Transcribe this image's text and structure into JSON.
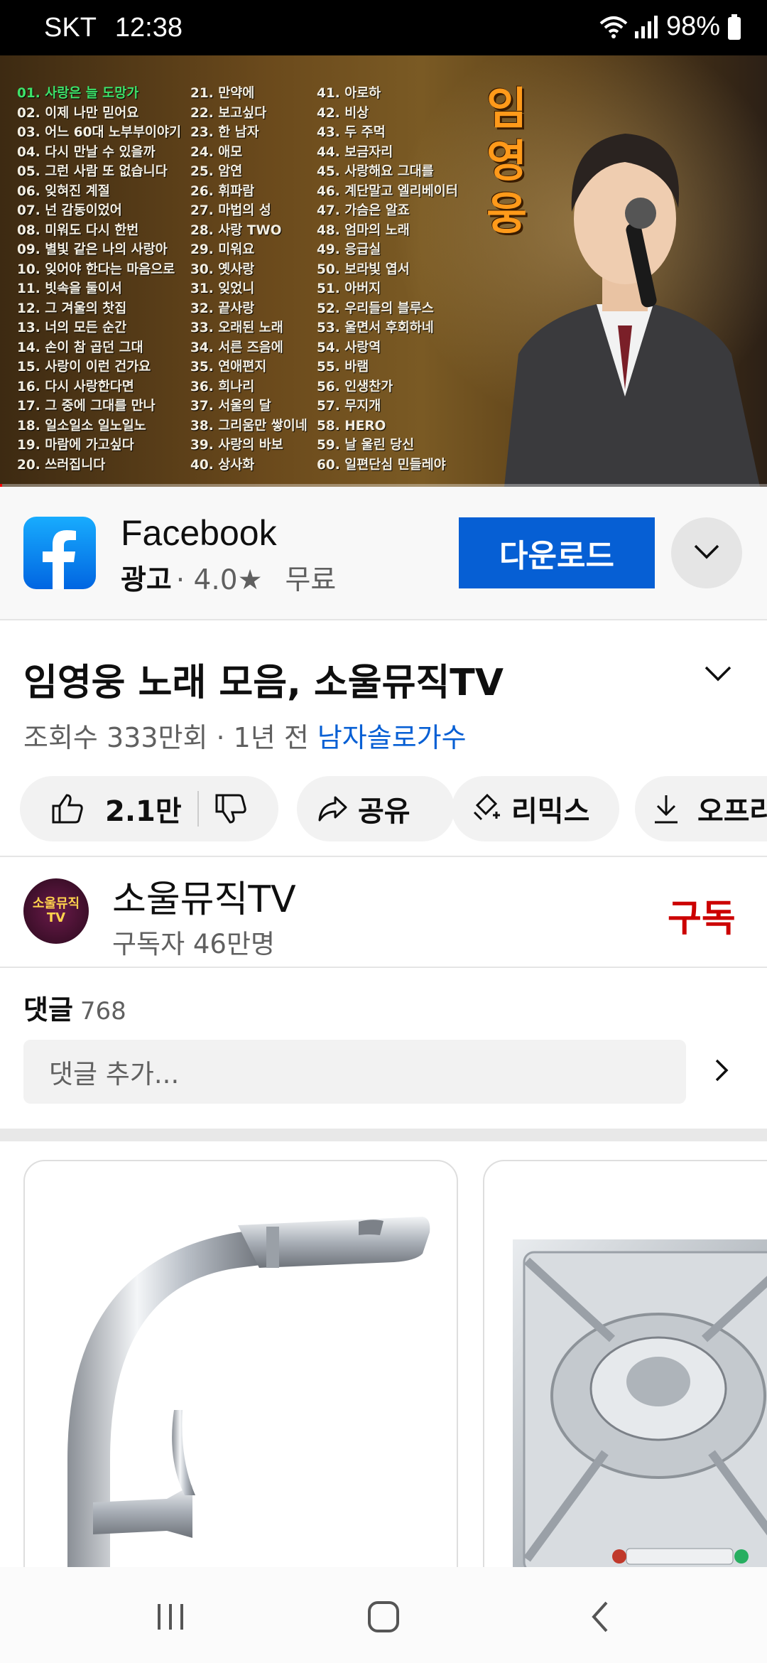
{
  "status_bar": {
    "carrier": "SKT",
    "time": "12:38",
    "battery": "98%"
  },
  "video": {
    "songs_col1": [
      "01. 사랑은 늘 도망가",
      "02. 이제 나만 믿어요",
      "03. 어느 60대 노부부이야기",
      "04. 다시 만날 수 있을까",
      "05. 그런 사람 또 없습니다",
      "06. 잊혀진 계절",
      "07. 넌 감동이었어",
      "08. 미워도 다시 한번",
      "09. 별빛 같은 나의 사랑아",
      "10. 잊어야 한다는 마음으로",
      "11. 빗속을 둘이서",
      "12. 그 겨울의 찻집",
      "13. 너의 모든 순간",
      "14. 손이 참 곱던 그대",
      "15. 사랑이 이런 건가요",
      "16. 다시 사랑한다면",
      "17. 그 중에 그대를 만나",
      "18. 일소일소 일노일노",
      "19. 마람에 가고싶다",
      "20. 쓰러집니다"
    ],
    "songs_col2": [
      "21. 만약에",
      "22. 보고싶다",
      "23. 한 남자",
      "24. 애모",
      "25. 암연",
      "26. 휘파람",
      "27. 마법의 성",
      "28. 사랑 TWO",
      "29. 미워요",
      "30. 옛사랑",
      "31. 잊었니",
      "32. 끝사랑",
      "33. 오래된 노래",
      "34. 서른 즈음에",
      "35. 연애편지",
      "36. 희나리",
      "37. 서울의 달",
      "38. 그리움만 쌓이네",
      "39. 사랑의 바보",
      "40. 상사화"
    ],
    "songs_col3": [
      "41. 아로하",
      "42. 비상",
      "43. 두 주먹",
      "44. 보금자리",
      "45. 사랑해요 그대를",
      "46. 계단말고 엘리베이터",
      "47. 가슴은 알죠",
      "48. 엄마의 노래",
      "49. 응급실",
      "50. 보라빛 엽서",
      "51. 아버지",
      "52. 우리들의 블루스",
      "53. 울면서 후회하네",
      "54. 사랑역",
      "55. 바램",
      "56. 인생찬가",
      "57. 무지개",
      "58. HERO",
      "59. 날 울린 당신",
      "60. 일편단심 민들레야"
    ],
    "artist_chars": [
      "임",
      "영",
      "웅"
    ],
    "progress": 0.003,
    "colors": {
      "highlight": "#3ee26a",
      "artist": "#ff9a1a"
    }
  },
  "ad": {
    "title": "Facebook",
    "label": "광고",
    "rating": "· 4.0★",
    "price": "무료",
    "cta": "다운로드",
    "icon": "facebook-icon",
    "cta_color": "#065fd4"
  },
  "video_info": {
    "title": "임영웅 노래 모음, 소울뮤직TV",
    "views": "조회수 333만회 · 1년 전",
    "hashtag": "남자솔로가수"
  },
  "actions": {
    "like_count": "2.1만",
    "share": "공유",
    "remix": "리믹스",
    "offline": "오프라"
  },
  "channel": {
    "name": "소울뮤직TV",
    "subscribers": "구독자 46만명",
    "subscribe": "구독",
    "avatar_text": "소울뮤직",
    "avatar_sub": "TV",
    "subscribe_color": "#cc0000"
  },
  "comments": {
    "label": "댓글",
    "count": "768",
    "placeholder": "댓글 추가..."
  }
}
